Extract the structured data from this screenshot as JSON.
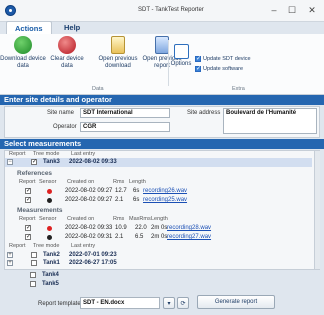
{
  "window": {
    "title": "SDT - TankTest Reporter",
    "min": "–",
    "max": "☐",
    "close": "✕"
  },
  "tabs": [
    {
      "label": "Actions"
    },
    {
      "label": "Help"
    }
  ],
  "ribbon": {
    "buttons": [
      {
        "label": "Download device data"
      },
      {
        "label": "Clear device data"
      },
      {
        "label": "Open previous download"
      },
      {
        "label": "Open previous report"
      },
      {
        "label": "Options"
      }
    ],
    "checks": [
      {
        "label": "Update SDT device"
      },
      {
        "label": "Update software"
      }
    ],
    "groups": {
      "data": "Data",
      "extra": "Extra"
    }
  },
  "site": {
    "header": "Enter site details and operator",
    "site_name_label": "Site name",
    "site_name": "SDT International",
    "operator_label": "Operator",
    "operator": "CGR",
    "site_address_label": "Site address",
    "site_address": "Boulevard de l'Humanité"
  },
  "measurements": {
    "header": "Select measurements",
    "cols": {
      "report": "Report",
      "tree_mode": "Tree mode",
      "last_entry": "Last entry"
    },
    "current_tank": {
      "name": "Tank3",
      "last_entry": "2022-08-02 09:33"
    },
    "references": {
      "label": "References",
      "cols": {
        "report": "Report",
        "sensor": "Sensor",
        "created": "Created on",
        "rms": "Rms",
        "length": "Length"
      },
      "rows": [
        {
          "created": "2022-08-02 09:27",
          "rms": "12.7",
          "length": "6s",
          "file": "recording26.wav"
        },
        {
          "created": "2022-08-02 09:27",
          "rms": "2.1",
          "length": "6s",
          "file": "recording25.wav"
        }
      ]
    },
    "measurements": {
      "label": "Measurements",
      "cols": {
        "report": "Report",
        "sensor": "Sensor",
        "created": "Created on",
        "rms": "Rms",
        "maxrms": "MaxRms",
        "length": "Length"
      },
      "rows": [
        {
          "created": "2022-08-02 09:33",
          "rms": "10.9",
          "maxrms": "22.0",
          "length": "2m 0s",
          "file": "recording28.wav"
        },
        {
          "created": "2022-08-02 09:31",
          "rms": "2.1",
          "maxrms": "6.5",
          "length": "2m 0s",
          "file": "recording27.wav"
        }
      ]
    },
    "other_tanks": [
      {
        "name": "Tank2",
        "last_entry": "2022-07-01 09:23"
      },
      {
        "name": "Tank1",
        "last_entry": "2022-06-27 17:05"
      },
      {
        "name": "Tank4",
        "last_entry": ""
      },
      {
        "name": "Tank5",
        "last_entry": ""
      }
    ]
  },
  "footer": {
    "template_label": "Report template",
    "template_value": "SDT - EN.docx",
    "generate": "Generate report"
  }
}
